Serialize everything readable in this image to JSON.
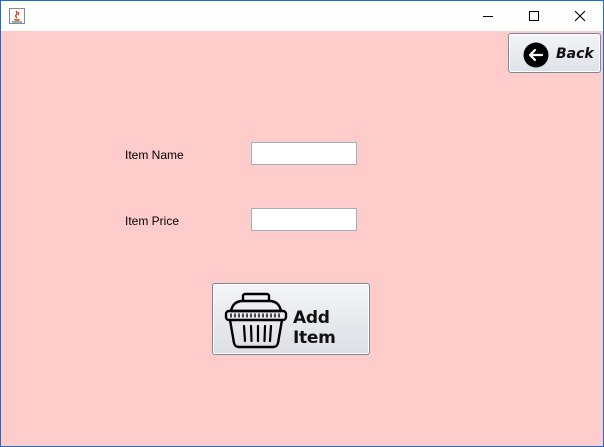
{
  "window": {
    "title": "",
    "controls": {
      "minimize": "minimize",
      "maximize": "maximize",
      "close": "close"
    }
  },
  "toolbar": {
    "back_label": "Back",
    "back_icon": "arrow-left-circle-icon"
  },
  "form": {
    "item_name_label": "Item Name",
    "item_name_value": "",
    "item_price_label": "Item Price",
    "item_price_value": "",
    "add_button_label": "Add Item",
    "add_button_icon": "basket-icon"
  },
  "colors": {
    "background": "#ffcccc",
    "titlebar": "#ffffff",
    "window_border": "#1d6fc4"
  }
}
